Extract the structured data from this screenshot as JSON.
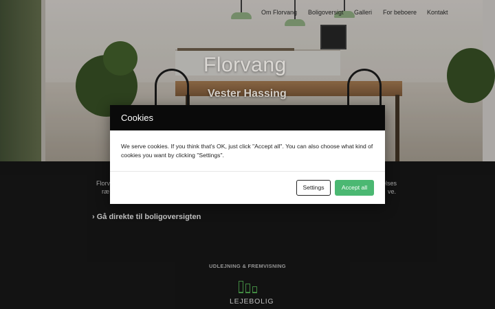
{
  "nav": {
    "items": [
      "Om Florvang",
      "Boligoversigt",
      "Galleri",
      "For beboere",
      "Kontakt"
    ]
  },
  "hero": {
    "title": "Florvang",
    "subtitle": "Vester Hassing"
  },
  "intro": {
    "left_fragment_1": "Florv",
    "left_fragment_2": "ræ",
    "right_fragment_1": "elses",
    "right_fragment_2": "ve."
  },
  "direct_link": "› Gå direkte til boligoversigten",
  "section": {
    "label": "UDLEJNING & FREMVISNING",
    "logo_text": "LEJEBOLIG"
  },
  "cookie_modal": {
    "title": "Cookies",
    "body": "We serve cookies. If you think that's OK, just click \"Accept all\". You can also choose what kind of cookies you want by clicking \"Settings\".",
    "settings_label": "Settings",
    "accept_label": "Accept all"
  },
  "colors": {
    "accent_green": "#4bb872",
    "modal_header": "#0a0a0a",
    "footer_bg": "#151515"
  }
}
